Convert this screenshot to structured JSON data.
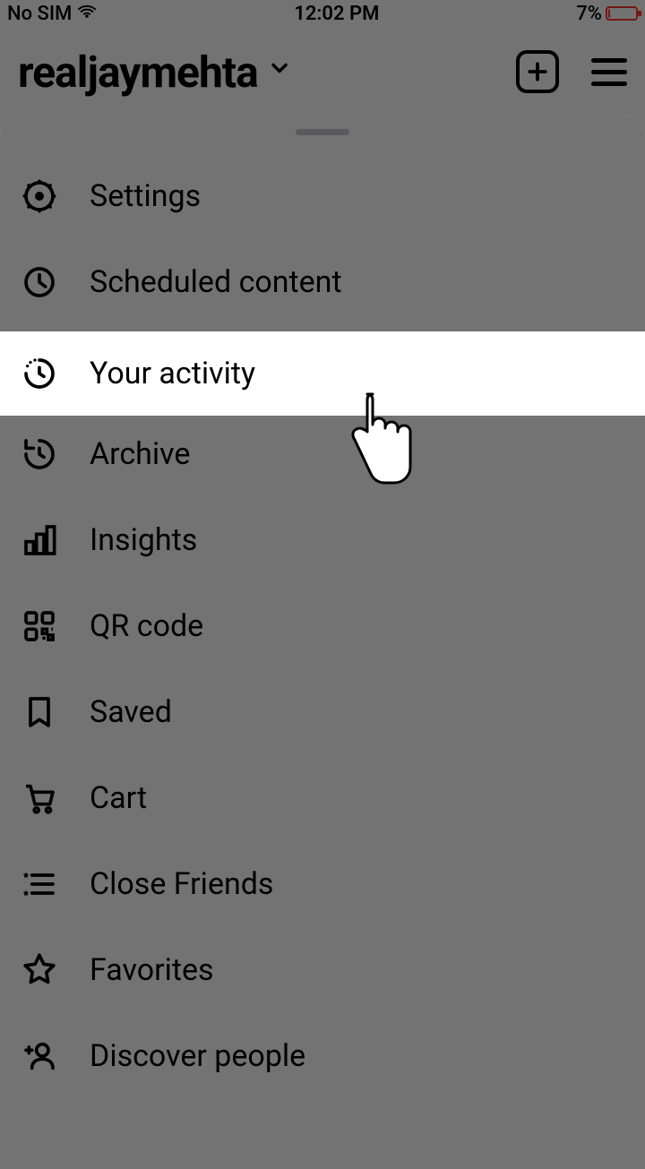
{
  "status": {
    "carrier": "No SIM",
    "time": "12:02 PM",
    "battery_pct": "7%"
  },
  "header": {
    "username": "realjaymehta"
  },
  "menu": {
    "items": [
      {
        "label": "Settings",
        "icon": "settings-icon"
      },
      {
        "label": "Scheduled content",
        "icon": "clock-icon"
      },
      {
        "label": "Your activity",
        "icon": "activity-icon",
        "highlighted": true
      },
      {
        "label": "Archive",
        "icon": "archive-icon"
      },
      {
        "label": "Insights",
        "icon": "insights-icon"
      },
      {
        "label": "QR code",
        "icon": "qr-icon"
      },
      {
        "label": "Saved",
        "icon": "bookmark-icon"
      },
      {
        "label": "Cart",
        "icon": "cart-icon"
      },
      {
        "label": "Close Friends",
        "icon": "close-friends-icon"
      },
      {
        "label": "Favorites",
        "icon": "star-icon"
      },
      {
        "label": "Discover people",
        "icon": "discover-people-icon"
      }
    ]
  }
}
